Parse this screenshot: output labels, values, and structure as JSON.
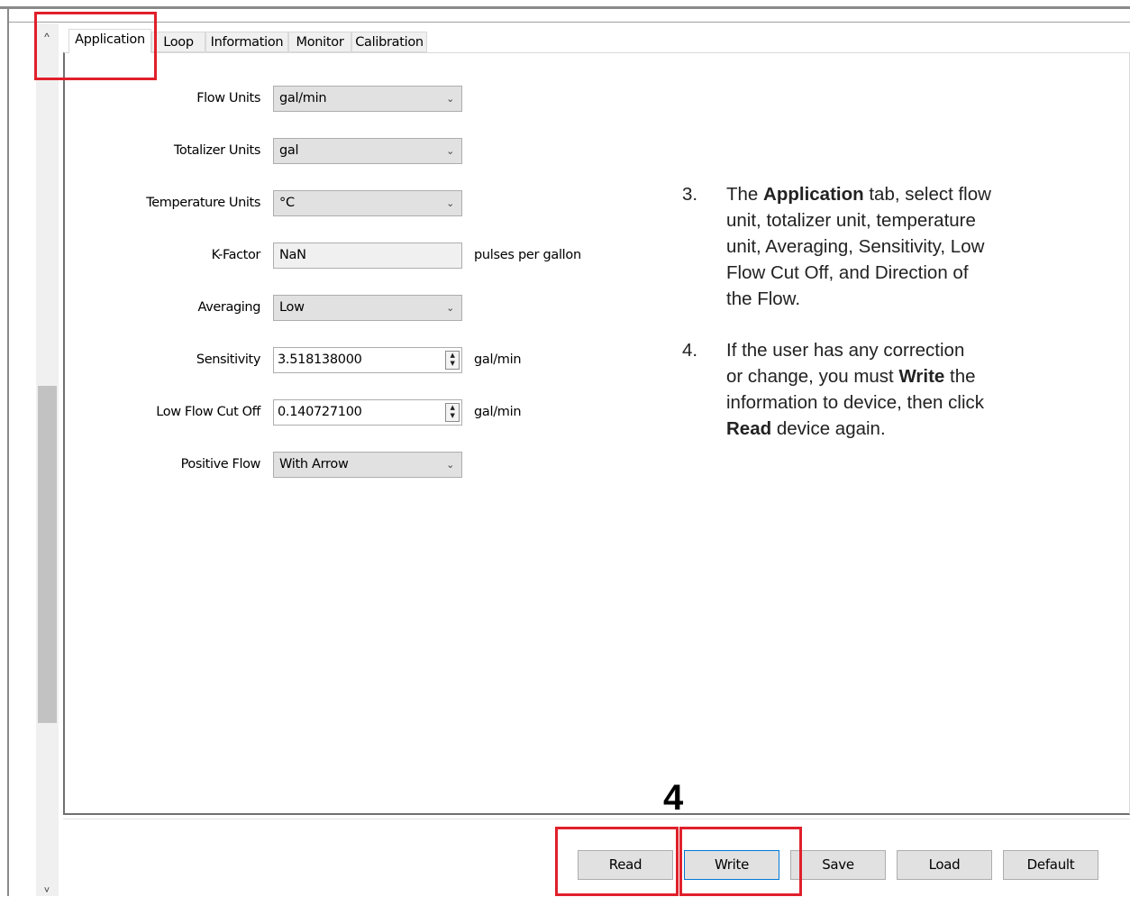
{
  "tabs": [
    {
      "label": "Application",
      "active": true
    },
    {
      "label": "Loop"
    },
    {
      "label": "Information"
    },
    {
      "label": "Monitor"
    },
    {
      "label": "Calibration"
    }
  ],
  "scrollbar": {
    "up_icon": "chevron-up",
    "down_icon": "chevron-down",
    "up_glyph": "^",
    "down_glyph": "˅"
  },
  "form": {
    "flow_units": {
      "label": "Flow Units",
      "value": "gal/min"
    },
    "totalizer_units": {
      "label": "Totalizer Units",
      "value": "gal"
    },
    "temperature_units": {
      "label": "Temperature Units",
      "value": "°C"
    },
    "k_factor": {
      "label": "K-Factor",
      "value": "NaN",
      "unit": "pulses per gallon"
    },
    "averaging": {
      "label": "Averaging",
      "value": "Low"
    },
    "sensitivity": {
      "label": "Sensitivity",
      "value": "3.518138000",
      "unit": "gal/min"
    },
    "low_flow_cut_off": {
      "label": "Low Flow Cut Off",
      "value": "0.140727100",
      "unit": "gal/min"
    },
    "positive_flow": {
      "label": "Positive Flow",
      "value": "With Arrow"
    }
  },
  "instructions": {
    "step3": {
      "number": "3.",
      "pre": "The ",
      "bold": "Application",
      "lines": [
        "tab, select flow",
        "unit, totalizer unit, temperature",
        "unit, Averaging, Sensitivity, Low",
        "Flow Cut Off, and Direction of",
        "the Flow."
      ]
    },
    "step4": {
      "number": "4.",
      "line1": "If the user has any correction",
      "line2_pre": "or change, you must ",
      "line2_bold": "Write",
      "line2_post": " the",
      "line3": "information to device, then click",
      "line4_bold": "Read",
      "line4_post": " device again."
    },
    "callout_number": "4"
  },
  "buttons": {
    "read": "Read",
    "write": "Write",
    "save": "Save",
    "load": "Load",
    "default": "Default"
  },
  "colors": {
    "highlight": "#e0202a",
    "button_bg": "#e1e1e1",
    "combo_bg": "#e1e1e1",
    "focus_border": "#0078d7"
  },
  "icons": {
    "dropdown": "chevron-down-icon",
    "spinner": "spinner-updown-icon"
  }
}
